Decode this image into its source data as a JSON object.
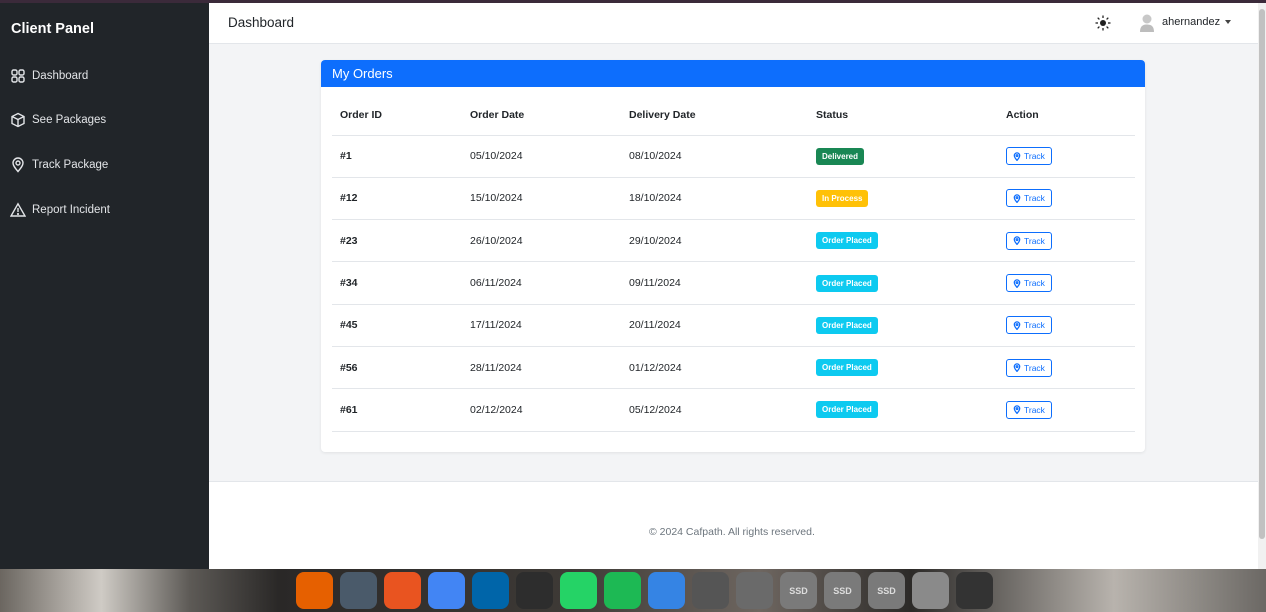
{
  "sidebar": {
    "brand": "Client Panel",
    "items": [
      {
        "label": "Dashboard",
        "icon": "grid-icon"
      },
      {
        "label": "See Packages",
        "icon": "box-icon"
      },
      {
        "label": "Track Package",
        "icon": "location-pin-icon"
      },
      {
        "label": "Report Incident",
        "icon": "warning-triangle-icon"
      }
    ]
  },
  "header": {
    "title": "Dashboard",
    "theme_icon": "sun-icon",
    "user": "ahernandez"
  },
  "orders": {
    "title": "My Orders",
    "columns": [
      "Order ID",
      "Order Date",
      "Delivery Date",
      "Status",
      "Action"
    ],
    "action_label": "Track",
    "rows": [
      {
        "id": "#1",
        "order_date": "05/10/2024",
        "delivery_date": "08/10/2024",
        "status": "Delivered",
        "status_color": "#198754"
      },
      {
        "id": "#12",
        "order_date": "15/10/2024",
        "delivery_date": "18/10/2024",
        "status": "In Process",
        "status_color": "#ffc107"
      },
      {
        "id": "#23",
        "order_date": "26/10/2024",
        "delivery_date": "29/10/2024",
        "status": "Order Placed",
        "status_color": "#0dcaf0"
      },
      {
        "id": "#34",
        "order_date": "06/11/2024",
        "delivery_date": "09/11/2024",
        "status": "Order Placed",
        "status_color": "#0dcaf0"
      },
      {
        "id": "#45",
        "order_date": "17/11/2024",
        "delivery_date": "20/11/2024",
        "status": "Order Placed",
        "status_color": "#0dcaf0"
      },
      {
        "id": "#56",
        "order_date": "28/11/2024",
        "delivery_date": "01/12/2024",
        "status": "Order Placed",
        "status_color": "#0dcaf0"
      },
      {
        "id": "#61",
        "order_date": "02/12/2024",
        "delivery_date": "05/12/2024",
        "status": "Order Placed",
        "status_color": "#0dcaf0"
      }
    ]
  },
  "footer": {
    "text": "© 2024 Cafpath. All rights reserved."
  },
  "colors": {
    "primary": "#0d6efd",
    "sidebar_bg": "#212529"
  },
  "dock": {
    "apps": [
      {
        "name": "firefox-icon",
        "color": "#e66000"
      },
      {
        "name": "files-icon",
        "color": "#4a5a6a"
      },
      {
        "name": "app-center-icon",
        "color": "#e95420"
      },
      {
        "name": "chrome-icon",
        "color": "#4285f4"
      },
      {
        "name": "vscode-icon",
        "color": "#0065a9"
      },
      {
        "name": "terminal-icon",
        "color": "#2d2d2d"
      },
      {
        "name": "whatsapp-icon",
        "color": "#25d366"
      },
      {
        "name": "spotify-icon",
        "color": "#1db954"
      },
      {
        "name": "help-icon",
        "color": "#3584e4"
      },
      {
        "name": "settings-icon",
        "color": "#555555"
      },
      {
        "name": "screenshot-icon",
        "color": "#6a6a6a"
      },
      {
        "name": "ssd-drive-icon",
        "color": "#7a7a7a",
        "label": "SSD"
      },
      {
        "name": "ssd-drive-icon",
        "color": "#7a7a7a",
        "label": "SSD"
      },
      {
        "name": "ssd-drive-icon",
        "color": "#7a7a7a",
        "label": "SSD"
      },
      {
        "name": "trash-icon",
        "color": "#8a8a8a"
      },
      {
        "name": "ubuntu-logo-icon",
        "color": "#333333"
      }
    ]
  }
}
